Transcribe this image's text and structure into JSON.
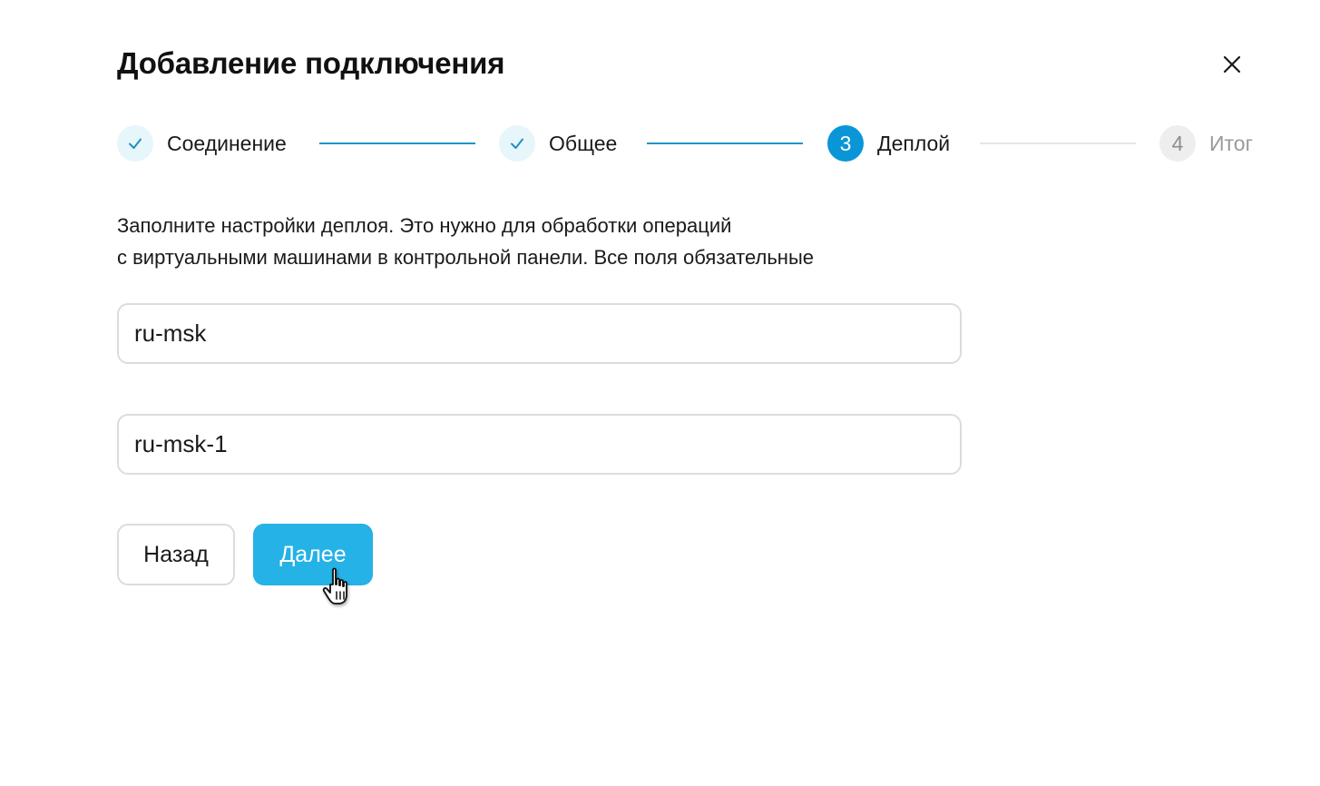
{
  "dialog": {
    "title": "Добавление подключения",
    "close_icon": "close-icon"
  },
  "stepper": {
    "steps": [
      {
        "marker": "✓",
        "label": "Соединение",
        "state": "done"
      },
      {
        "marker": "✓",
        "label": "Общее",
        "state": "done"
      },
      {
        "marker": "3",
        "label": "Деплой",
        "state": "current"
      },
      {
        "marker": "4",
        "label": "Итог",
        "state": "future"
      }
    ]
  },
  "form": {
    "description_line1": "Заполните настройки деплоя. Это нужно для обработки операций",
    "description_line2": "с виртуальными машинами в контрольной панели. Все поля обязательные",
    "field_1_value": "ru-msk",
    "field_2_value": "ru-msk-1"
  },
  "actions": {
    "back_label": "Назад",
    "next_label": "Далее"
  },
  "colors": {
    "accent": "#0a96d6",
    "primary_button": "#25b2e6",
    "done_step_bg": "#e6f6fb",
    "border": "#dcdcdc"
  },
  "icons": {
    "check": "check-icon",
    "close": "close-icon",
    "cursor": "hand-pointer-icon"
  }
}
